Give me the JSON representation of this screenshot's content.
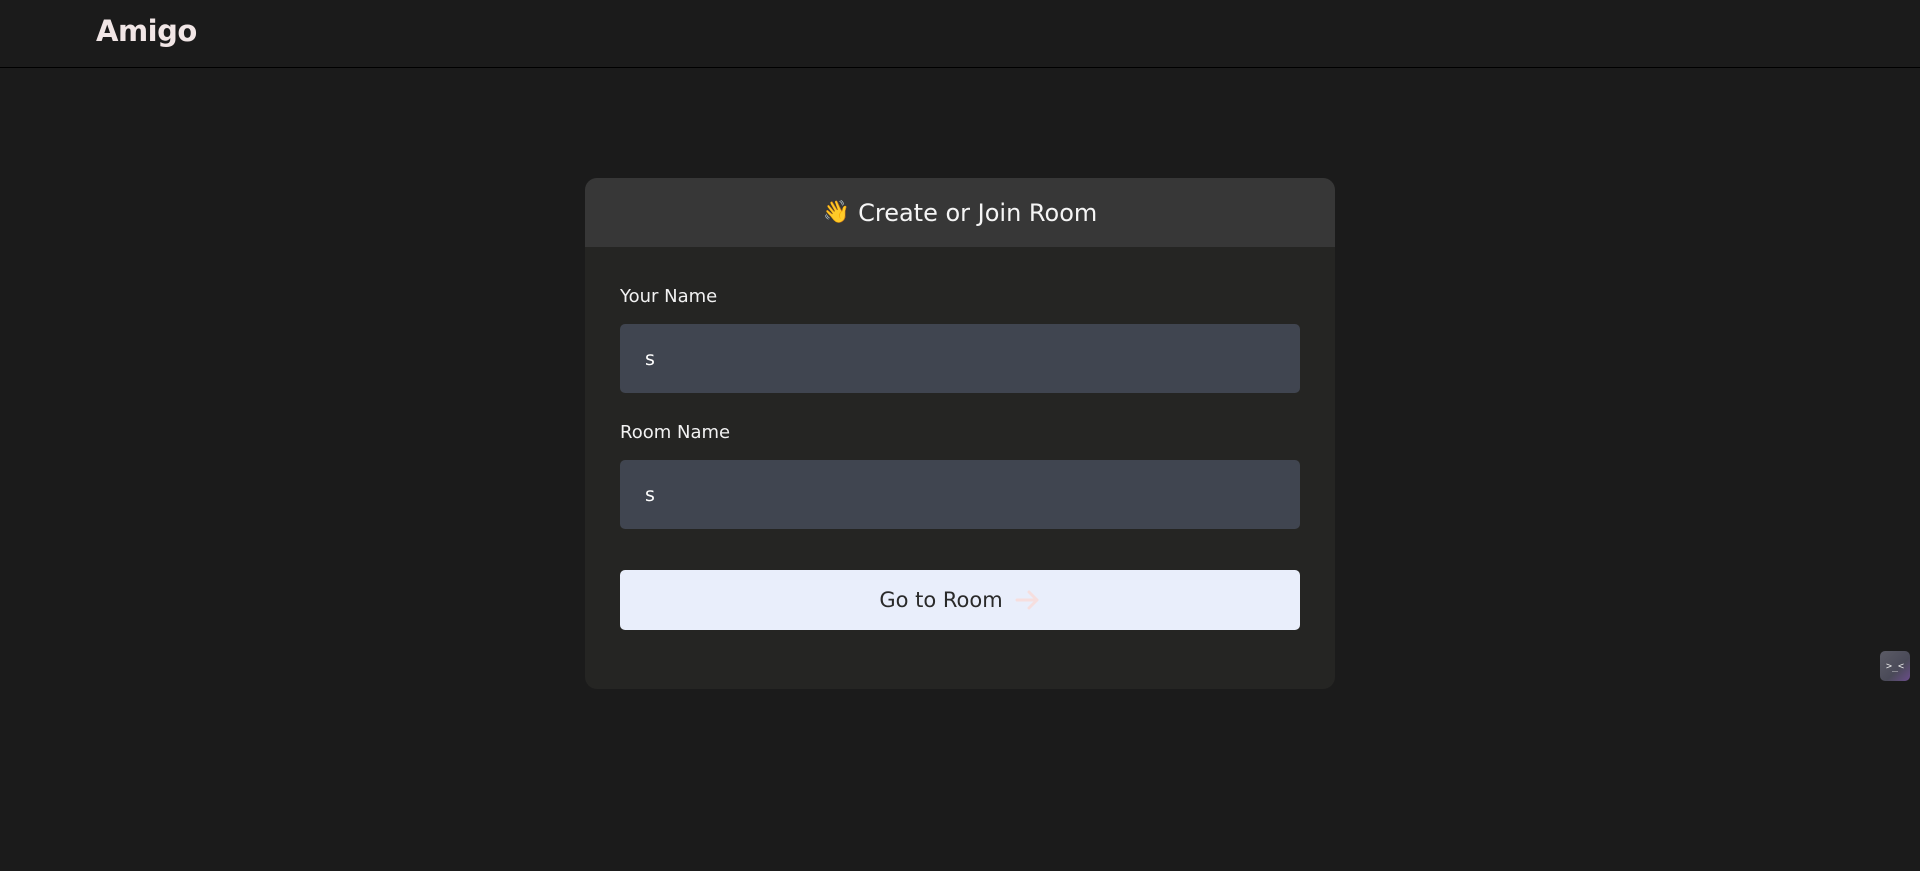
{
  "navbar": {
    "brand": "Amigo"
  },
  "card": {
    "title_icon": "waving-hand-icon",
    "title_emoji": "👋",
    "title": "Create or Join Room",
    "name_field": {
      "label": "Your Name",
      "value": "s"
    },
    "room_field": {
      "label": "Room Name",
      "value": "s"
    },
    "submit": {
      "label": "Go to Room",
      "icon": "arrow-right-icon"
    }
  },
  "helper_widget": {
    "icon": "face-icon",
    "glyph": ">_<"
  },
  "colors": {
    "background": "#1b1b1b",
    "card": "#252523",
    "card_header": "#373737",
    "input": "#404550",
    "button": "#e9eefb",
    "arrow": "#f6dede"
  }
}
